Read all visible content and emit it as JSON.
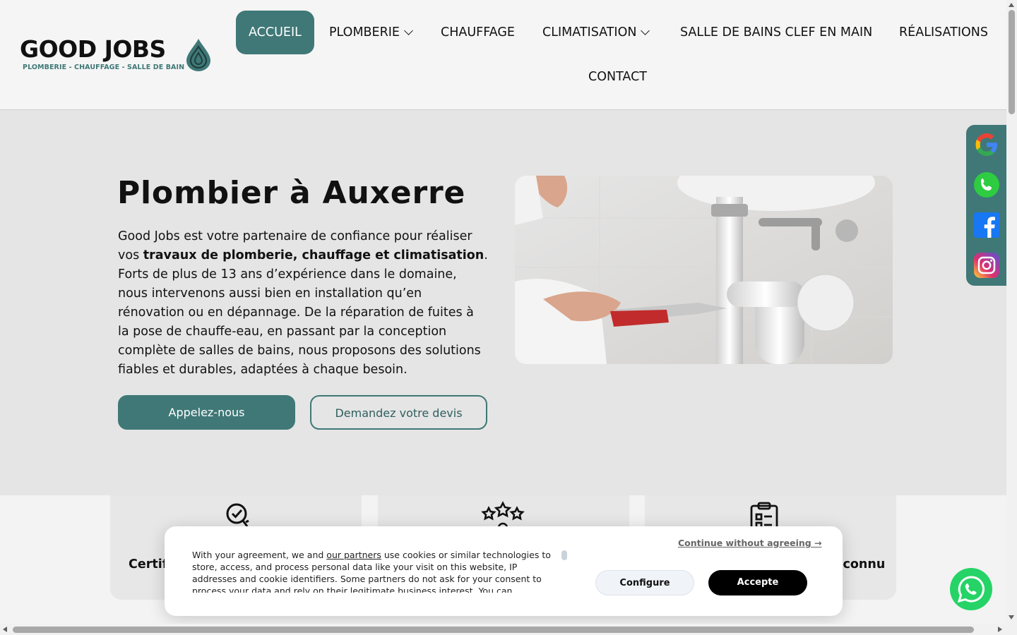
{
  "logo": {
    "name": "GOOD JOBS",
    "tagline": "PLOMBERIE - CHAUFFAGE - SALLE DE BAIN"
  },
  "nav": {
    "items": [
      {
        "label": "ACCUEIL"
      },
      {
        "label": "PLOMBERIE"
      },
      {
        "label": "CHAUFFAGE"
      },
      {
        "label": "CLIMATISATION"
      },
      {
        "label": "SALLE DE BAINS CLEF EN MAIN"
      },
      {
        "label": "RÉALISATIONS"
      },
      {
        "label": "CONTACT"
      }
    ]
  },
  "hero": {
    "title": "Plombier à Auxerre",
    "text_before": "Good Jobs est votre partenaire de confiance pour réaliser vos ",
    "text_bold": "travaux de plomberie, chauffage et climatisation",
    "text_after": ". Forts de plus de 13 ans d’expérience dans le domaine, nous intervenons aussi bien en installation qu’en rénovation ou en dépannage. De la réparation de fuites à la pose de chauffe-eau, en passant par la conception complète de salles de bains, nous proposons des solutions fiables et durables, adaptées à chaque besoin.",
    "cta_call": "Appelez-nous",
    "cta_quote": "Demandez votre devis"
  },
  "features": [
    {
      "label": "Certifi"
    },
    {
      "label": ""
    },
    {
      "label": "reconnu"
    }
  ],
  "cookie": {
    "text_before": "With your agreement, we and ",
    "link": "our partners",
    "text_after": " use cookies or similar technologies to store, access, and process personal data like your visit on this website, IP addresses and cookie identifiers. Some partners do not ask for your consent to process your data and rely on their legitimate business interest. You can",
    "continue": "Continue without agreeing →",
    "configure": "Configure",
    "accept": "Accepte"
  },
  "colors": {
    "accent": "#3f7877",
    "whatsapp": "#25d366"
  },
  "icons": {
    "social": [
      "google-icon",
      "phone-icon",
      "facebook-icon",
      "instagram-icon"
    ],
    "features": [
      "certified-check-icon",
      "stars-rating-icon",
      "clipboard-icon"
    ]
  }
}
